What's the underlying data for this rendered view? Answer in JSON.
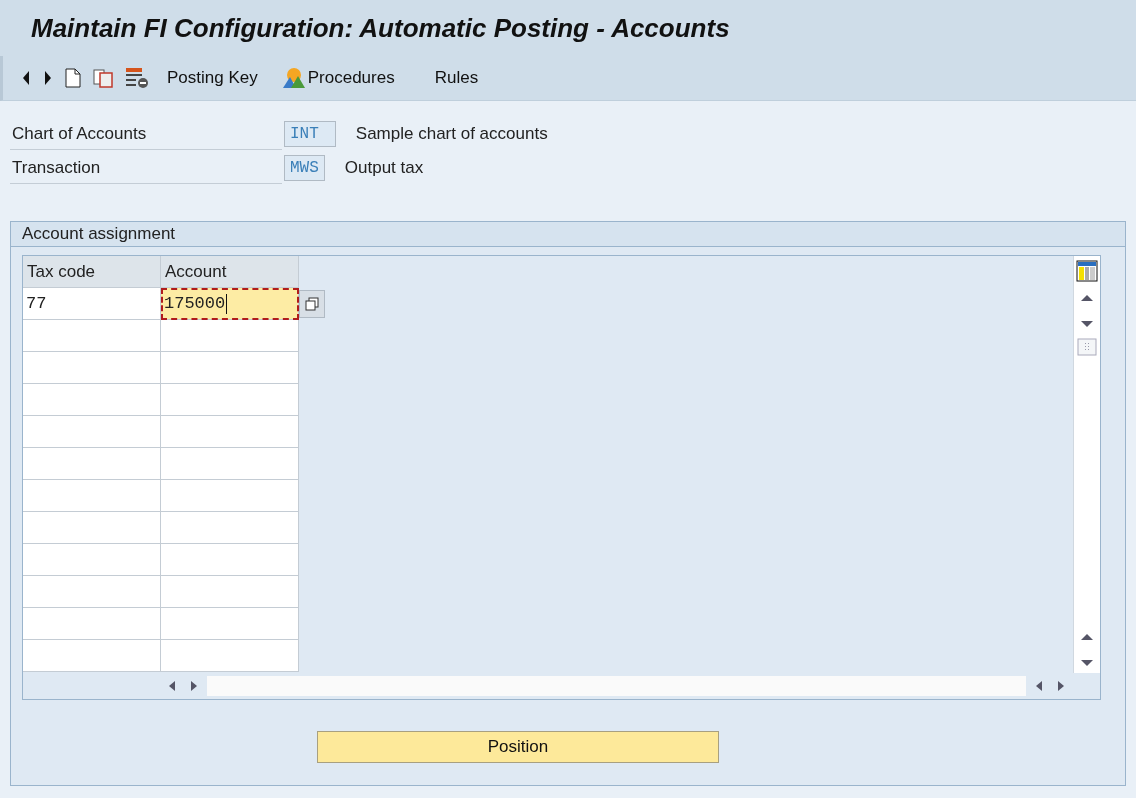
{
  "window": {
    "title": "Maintain FI Configuration: Automatic Posting - Accounts"
  },
  "toolbar": {
    "items": [
      {
        "kind": "text",
        "label": "Posting Key"
      },
      {
        "kind": "icon-text",
        "label": "Procedures"
      },
      {
        "kind": "text",
        "label": "Rules"
      }
    ]
  },
  "header_fields": [
    {
      "label": "Chart of Accounts",
      "value": "INT",
      "description": "Sample chart of accounts"
    },
    {
      "label": "Transaction",
      "value": "MWS",
      "description": "Output tax"
    }
  ],
  "group": {
    "title": "Account assignment",
    "table": {
      "columns": [
        "Tax code",
        "Account"
      ],
      "rows": [
        {
          "cells": [
            {
              "text": "77",
              "focused": false
            },
            {
              "text": "175000",
              "focused": true
            }
          ]
        }
      ]
    }
  },
  "buttons": [
    {
      "label": "Position"
    }
  ]
}
